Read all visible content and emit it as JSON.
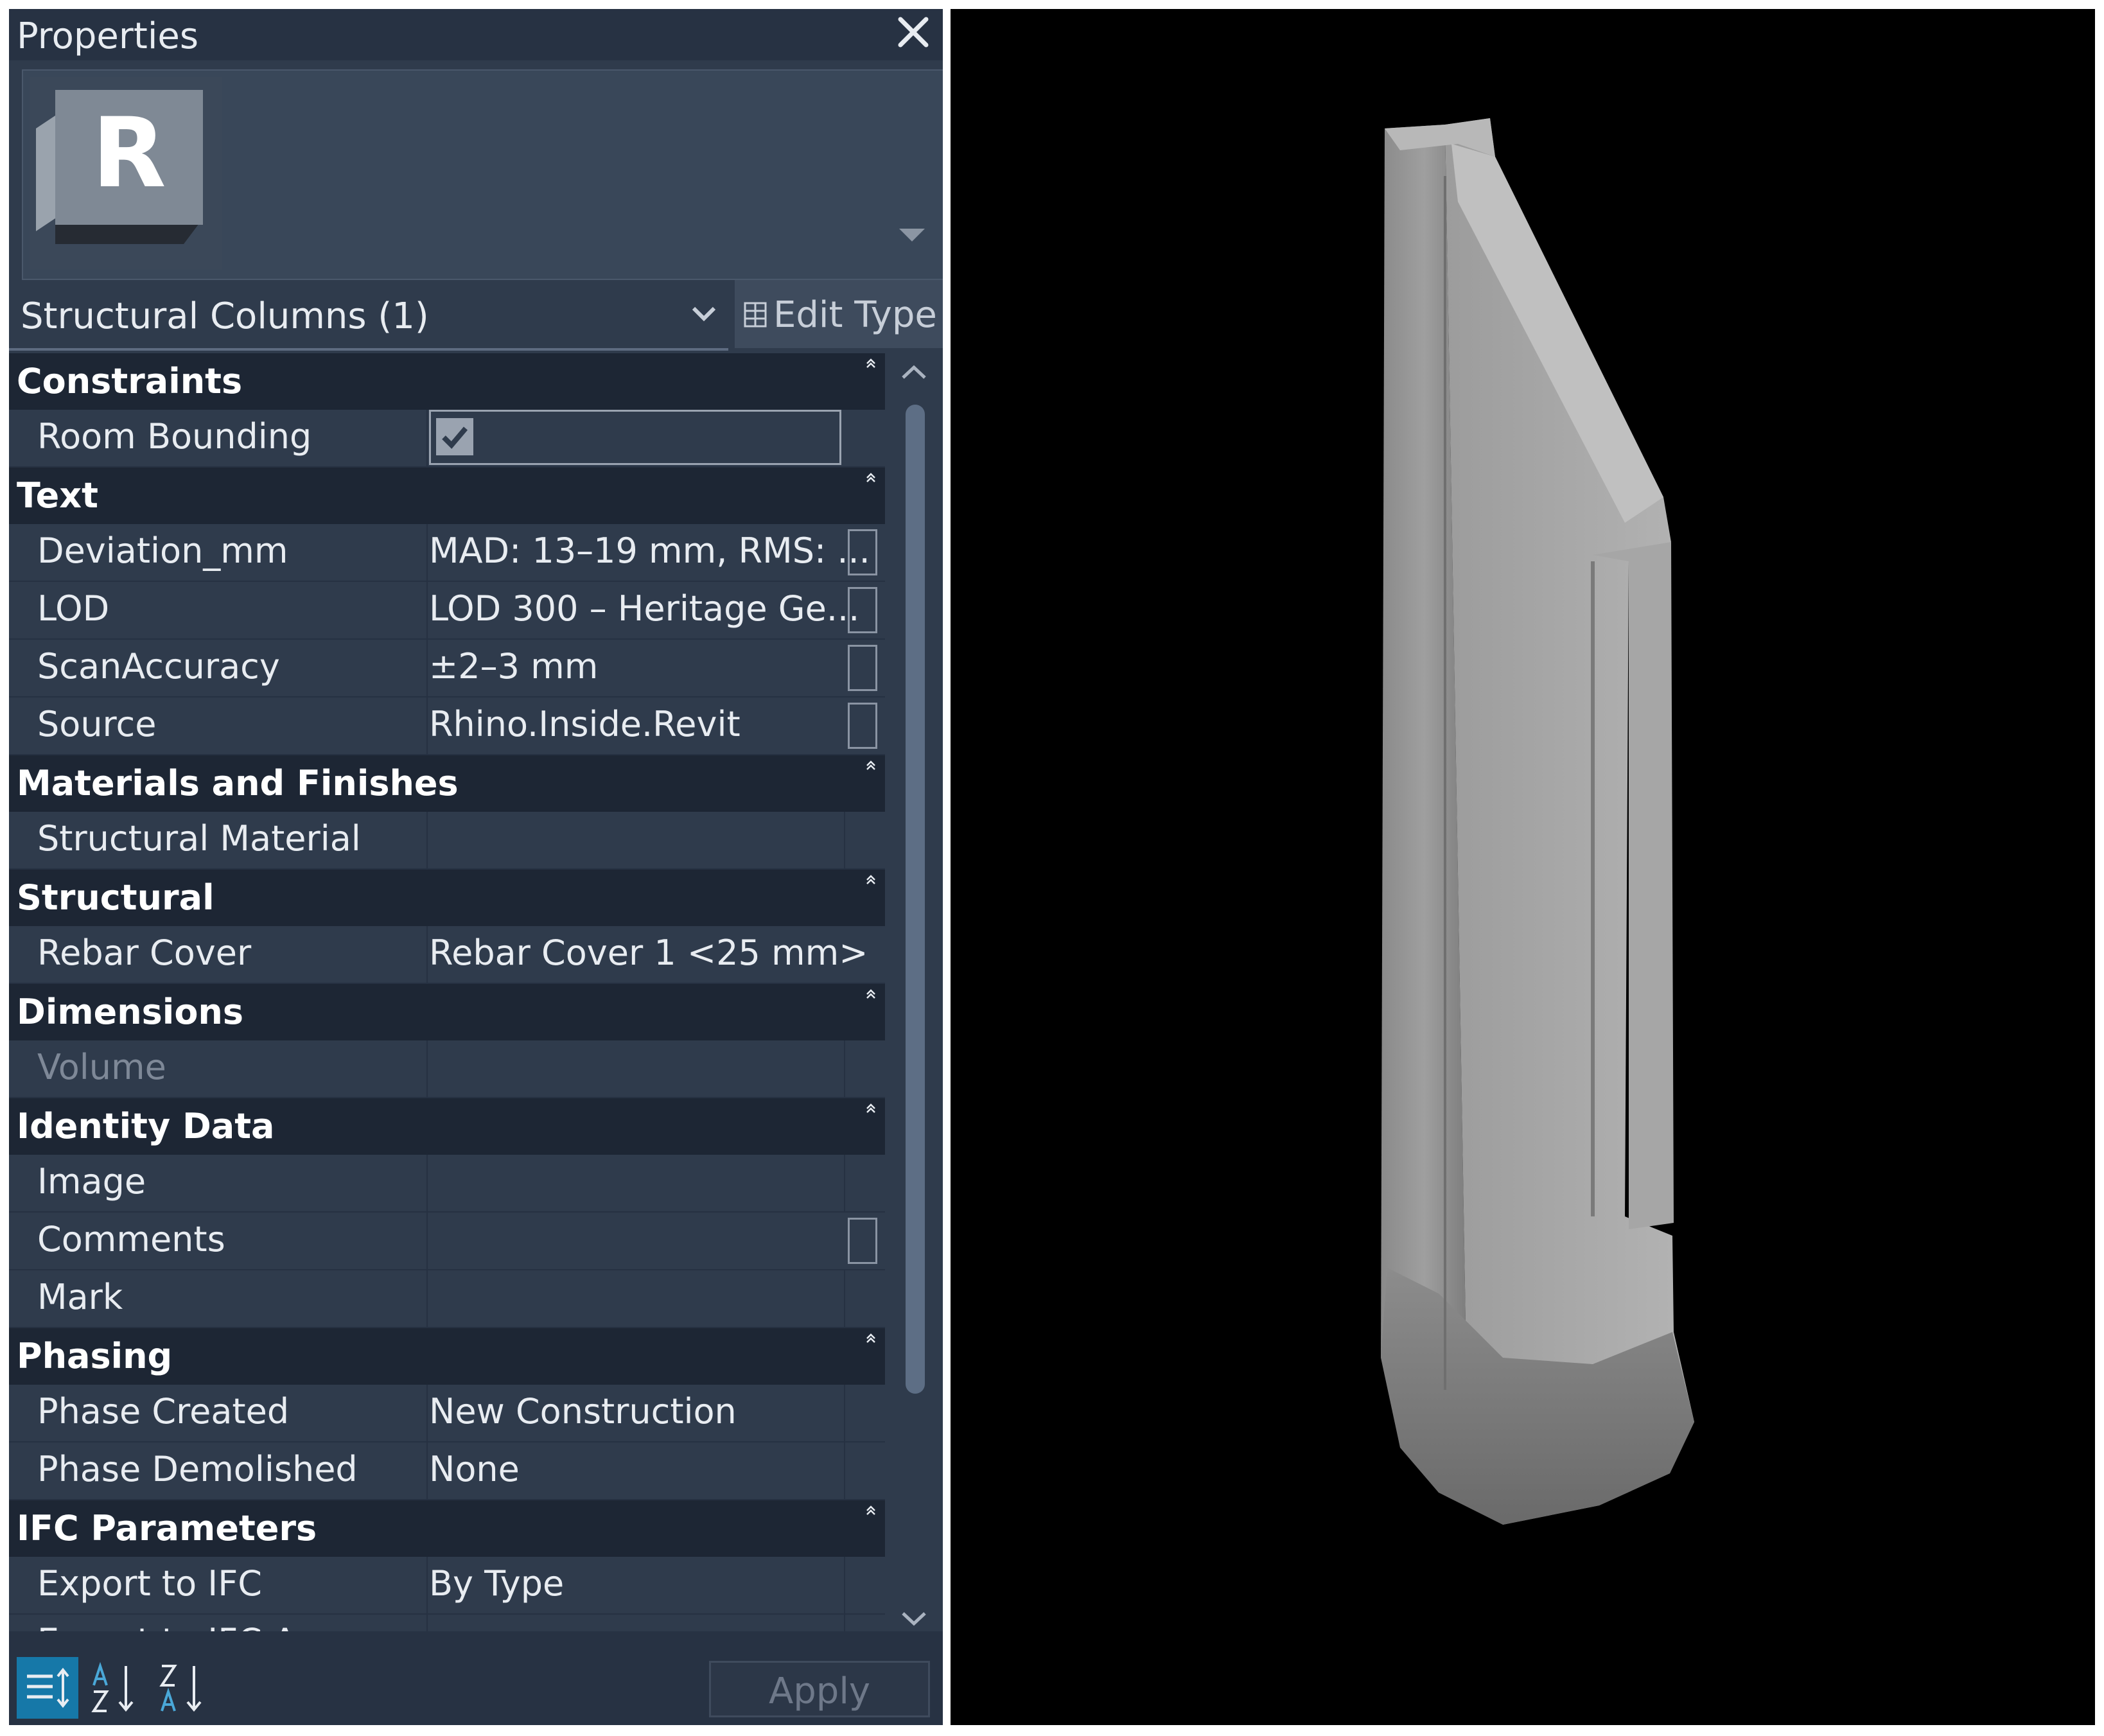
{
  "panel": {
    "title": "Properties",
    "logo_letter": "R",
    "type_selector": "Structural Columns (1)",
    "edit_type_label": "Edit Type",
    "apply_label": "Apply"
  },
  "sections": [
    {
      "name": "Constraints",
      "rows": [
        {
          "name": "Room Bounding",
          "value": "",
          "checked": true
        }
      ]
    },
    {
      "name": "Text",
      "rows": [
        {
          "name": "Deviation_mm",
          "value": "MAD: 13–19 mm, RMS: ...",
          "button": true
        },
        {
          "name": "LOD",
          "value": "LOD 300 – Heritage Ge...",
          "button": true
        },
        {
          "name": "ScanAccuracy",
          "value": "±2–3 mm",
          "button": true
        },
        {
          "name": "Source",
          "value": "Rhino.Inside.Revit",
          "button": true
        }
      ]
    },
    {
      "name": "Materials and Finishes",
      "rows": [
        {
          "name": "Structural Material",
          "value": ""
        }
      ]
    },
    {
      "name": "Structural",
      "rows": [
        {
          "name": "Rebar Cover",
          "value": "Rebar Cover 1 <25 mm>"
        }
      ]
    },
    {
      "name": "Dimensions",
      "rows": [
        {
          "name": "Volume",
          "value": "",
          "disabled": true
        }
      ]
    },
    {
      "name": "Identity Data",
      "rows": [
        {
          "name": "Image",
          "value": ""
        },
        {
          "name": "Comments",
          "value": "",
          "button": true
        },
        {
          "name": "Mark",
          "value": ""
        }
      ]
    },
    {
      "name": "Phasing",
      "rows": [
        {
          "name": "Phase Created",
          "value": "New Construction"
        },
        {
          "name": "Phase Demolished",
          "value": "None"
        }
      ]
    },
    {
      "name": "IFC Parameters",
      "rows": [
        {
          "name": "Export to IFC",
          "value": "By Type"
        },
        {
          "name": "Export to IFC As",
          "value": ""
        }
      ]
    }
  ],
  "icons": {
    "close": "close-icon",
    "dropdown": "chevron-down-icon",
    "edit_type": "edit-type-icon",
    "collapse": "collapse-icon",
    "checkmark": "checkmark-icon",
    "sort_category": "sort-by-category-icon",
    "sort_az": "sort-ascending-icon",
    "sort_za": "sort-descending-icon"
  },
  "colors": {
    "panel_bg": "#2f3b4c",
    "section_bg": "#1d2634",
    "accent": "#1678a8",
    "viewport_bg": "#000000"
  }
}
